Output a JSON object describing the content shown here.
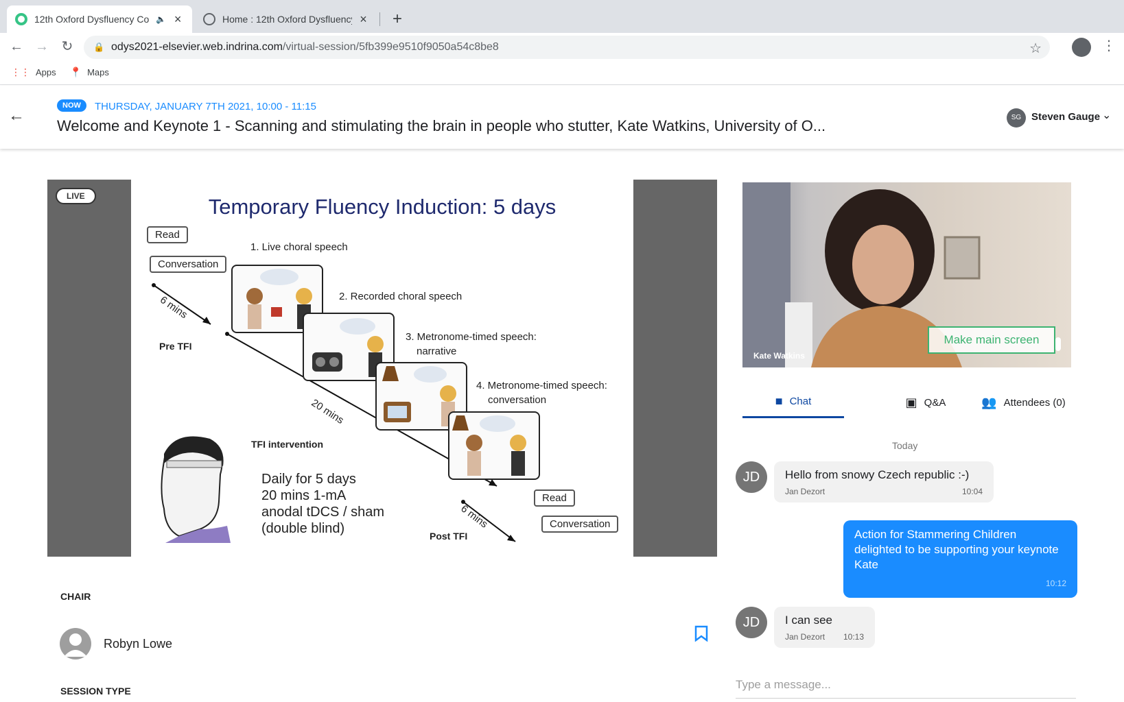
{
  "browser": {
    "tabs": [
      {
        "title": "12th Oxford Dysfluency Co",
        "active": true,
        "audio": true
      },
      {
        "title": "Home : 12th Oxford Dysfluency",
        "active": false
      }
    ],
    "url_host": "odys2021-elsevier.web.indrina.com",
    "url_path": "/virtual-session/5fb399e9510f9050a54c8be8",
    "bookmarks": [
      {
        "label": "Apps",
        "icon": "apps-grid-icon"
      },
      {
        "label": "Maps",
        "icon": "maps-icon"
      }
    ]
  },
  "header": {
    "badge": "NOW",
    "date": "THURSDAY, JANUARY 7TH 2021, 10:00 - 11:15",
    "title": "Welcome and Keynote 1 - Scanning and stimulating the brain in people who stutter, Kate Watkins, University of O...",
    "user_initials": "SG",
    "user_name": "Steven Gauge"
  },
  "stream": {
    "live_label": "LIVE",
    "slide": {
      "title": "Temporary Fluency Induction: 5 days",
      "read_top": "Read",
      "conversation_top": "Conversation",
      "six_mins_pre": "6 mins",
      "pre_tfi": "Pre TFI",
      "twenty_mins": "20 mins",
      "tfi_intervention": "TFI intervention",
      "six_mins_post": "6 mins",
      "post_tfi": "Post TFI",
      "read_bottom": "Read",
      "conversation_bottom": "Conversation",
      "steps": [
        "1. Live choral speech",
        "2. Recorded choral speech",
        "3. Metronome-timed speech:",
        "narrative",
        "4. Metronome-timed speech:",
        "conversation"
      ],
      "daily_lines": [
        "Daily for 5 days",
        "20 mins 1-mA",
        "anodal tDCS / sham",
        "(double blind)"
      ]
    }
  },
  "chair": {
    "label": "CHAIR",
    "name": "Robyn Lowe"
  },
  "session_type_label": "SESSION TYPE",
  "speaker": {
    "name_overlay": "Kate Watkins",
    "make_main_label": "Make main screen"
  },
  "chat_tabs": [
    {
      "label": "Chat",
      "icon": "chat-icon",
      "active": true
    },
    {
      "label": "Q&A",
      "icon": "qa-icon",
      "active": false
    },
    {
      "label": "Attendees (0)",
      "icon": "attendees-icon",
      "active": false
    }
  ],
  "chat": {
    "day": "Today",
    "messages": [
      {
        "initials": "JD",
        "text": "Hello from snowy Czech republic :-)",
        "author": "Jan Dezort",
        "time": "10:04",
        "mine": false
      },
      {
        "initials": "",
        "text": "Action for Stammering Children delighted to be supporting your keynote Kate",
        "author": "",
        "time": "10:12",
        "mine": true
      },
      {
        "initials": "JD",
        "text": "I can see",
        "author": "Jan Dezort",
        "time": "10:13",
        "mine": false
      }
    ],
    "input_placeholder": "Type a message..."
  },
  "colors": {
    "accent": "#1a8cff",
    "tab_active": "#0d47a1",
    "make_main": "#3cb371"
  }
}
